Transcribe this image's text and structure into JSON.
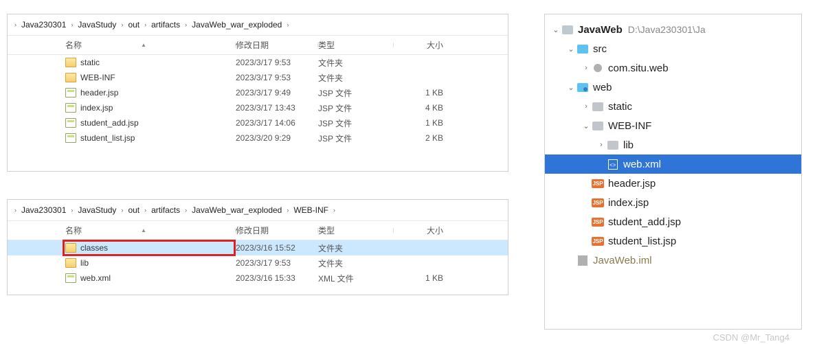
{
  "explorer1": {
    "breadcrumb": [
      "Java230301",
      "JavaStudy",
      "out",
      "artifacts",
      "JavaWeb_war_exploded"
    ],
    "columns": {
      "name": "名称",
      "date": "修改日期",
      "type": "类型",
      "size": "大小"
    },
    "rows": [
      {
        "icon": "folder",
        "name": "static",
        "date": "2023/3/17 9:53",
        "type": "文件夹",
        "size": ""
      },
      {
        "icon": "folder",
        "name": "WEB-INF",
        "date": "2023/3/17 9:53",
        "type": "文件夹",
        "size": ""
      },
      {
        "icon": "jsp",
        "name": "header.jsp",
        "date": "2023/3/17 9:49",
        "type": "JSP 文件",
        "size": "1 KB"
      },
      {
        "icon": "jsp",
        "name": "index.jsp",
        "date": "2023/3/17 13:43",
        "type": "JSP 文件",
        "size": "4 KB"
      },
      {
        "icon": "jsp",
        "name": "student_add.jsp",
        "date": "2023/3/17 14:06",
        "type": "JSP 文件",
        "size": "1 KB"
      },
      {
        "icon": "jsp",
        "name": "student_list.jsp",
        "date": "2023/3/20 9:29",
        "type": "JSP 文件",
        "size": "2 KB"
      }
    ]
  },
  "explorer2": {
    "breadcrumb": [
      "Java230301",
      "JavaStudy",
      "out",
      "artifacts",
      "JavaWeb_war_exploded",
      "WEB-INF"
    ],
    "columns": {
      "name": "名称",
      "date": "修改日期",
      "type": "类型",
      "size": "大小"
    },
    "rows": [
      {
        "icon": "folder",
        "name": "classes",
        "date": "2023/3/16 15:52",
        "type": "文件夹",
        "size": "",
        "selected": true,
        "highlight": true
      },
      {
        "icon": "folder",
        "name": "lib",
        "date": "2023/3/17 9:53",
        "type": "文件夹",
        "size": ""
      },
      {
        "icon": "xml",
        "name": "web.xml",
        "date": "2023/3/16 15:33",
        "type": "XML 文件",
        "size": "1 KB"
      }
    ]
  },
  "ide": {
    "tree": [
      {
        "indent": 0,
        "arrow": "v",
        "icon": "module",
        "label": "JavaWeb",
        "bold": true,
        "path": "D:\\Java230301\\Ja"
      },
      {
        "indent": 1,
        "arrow": "v",
        "icon": "src",
        "label": "src"
      },
      {
        "indent": 2,
        "arrow": ">",
        "icon": "pkg",
        "label": "com.situ.web"
      },
      {
        "indent": 1,
        "arrow": "v",
        "icon": "web",
        "label": "web"
      },
      {
        "indent": 2,
        "arrow": ">",
        "icon": "dir",
        "label": "static"
      },
      {
        "indent": 2,
        "arrow": "v",
        "icon": "dir",
        "label": "WEB-INF"
      },
      {
        "indent": 3,
        "arrow": ">",
        "icon": "dir",
        "label": "lib"
      },
      {
        "indent": 3,
        "arrow": "",
        "icon": "xmlf",
        "label": "web.xml",
        "selected": true
      },
      {
        "indent": 2,
        "arrow": "",
        "icon": "jspf",
        "label": "header.jsp"
      },
      {
        "indent": 2,
        "arrow": "",
        "icon": "jspf",
        "label": "index.jsp"
      },
      {
        "indent": 2,
        "arrow": "",
        "icon": "jspf",
        "label": "student_add.jsp"
      },
      {
        "indent": 2,
        "arrow": "",
        "icon": "jspf",
        "label": "student_list.jsp"
      },
      {
        "indent": 1,
        "arrow": "",
        "icon": "iml",
        "label": "JavaWeb.iml",
        "dim": true
      }
    ]
  },
  "watermark": "CSDN @Mr_Tang4"
}
